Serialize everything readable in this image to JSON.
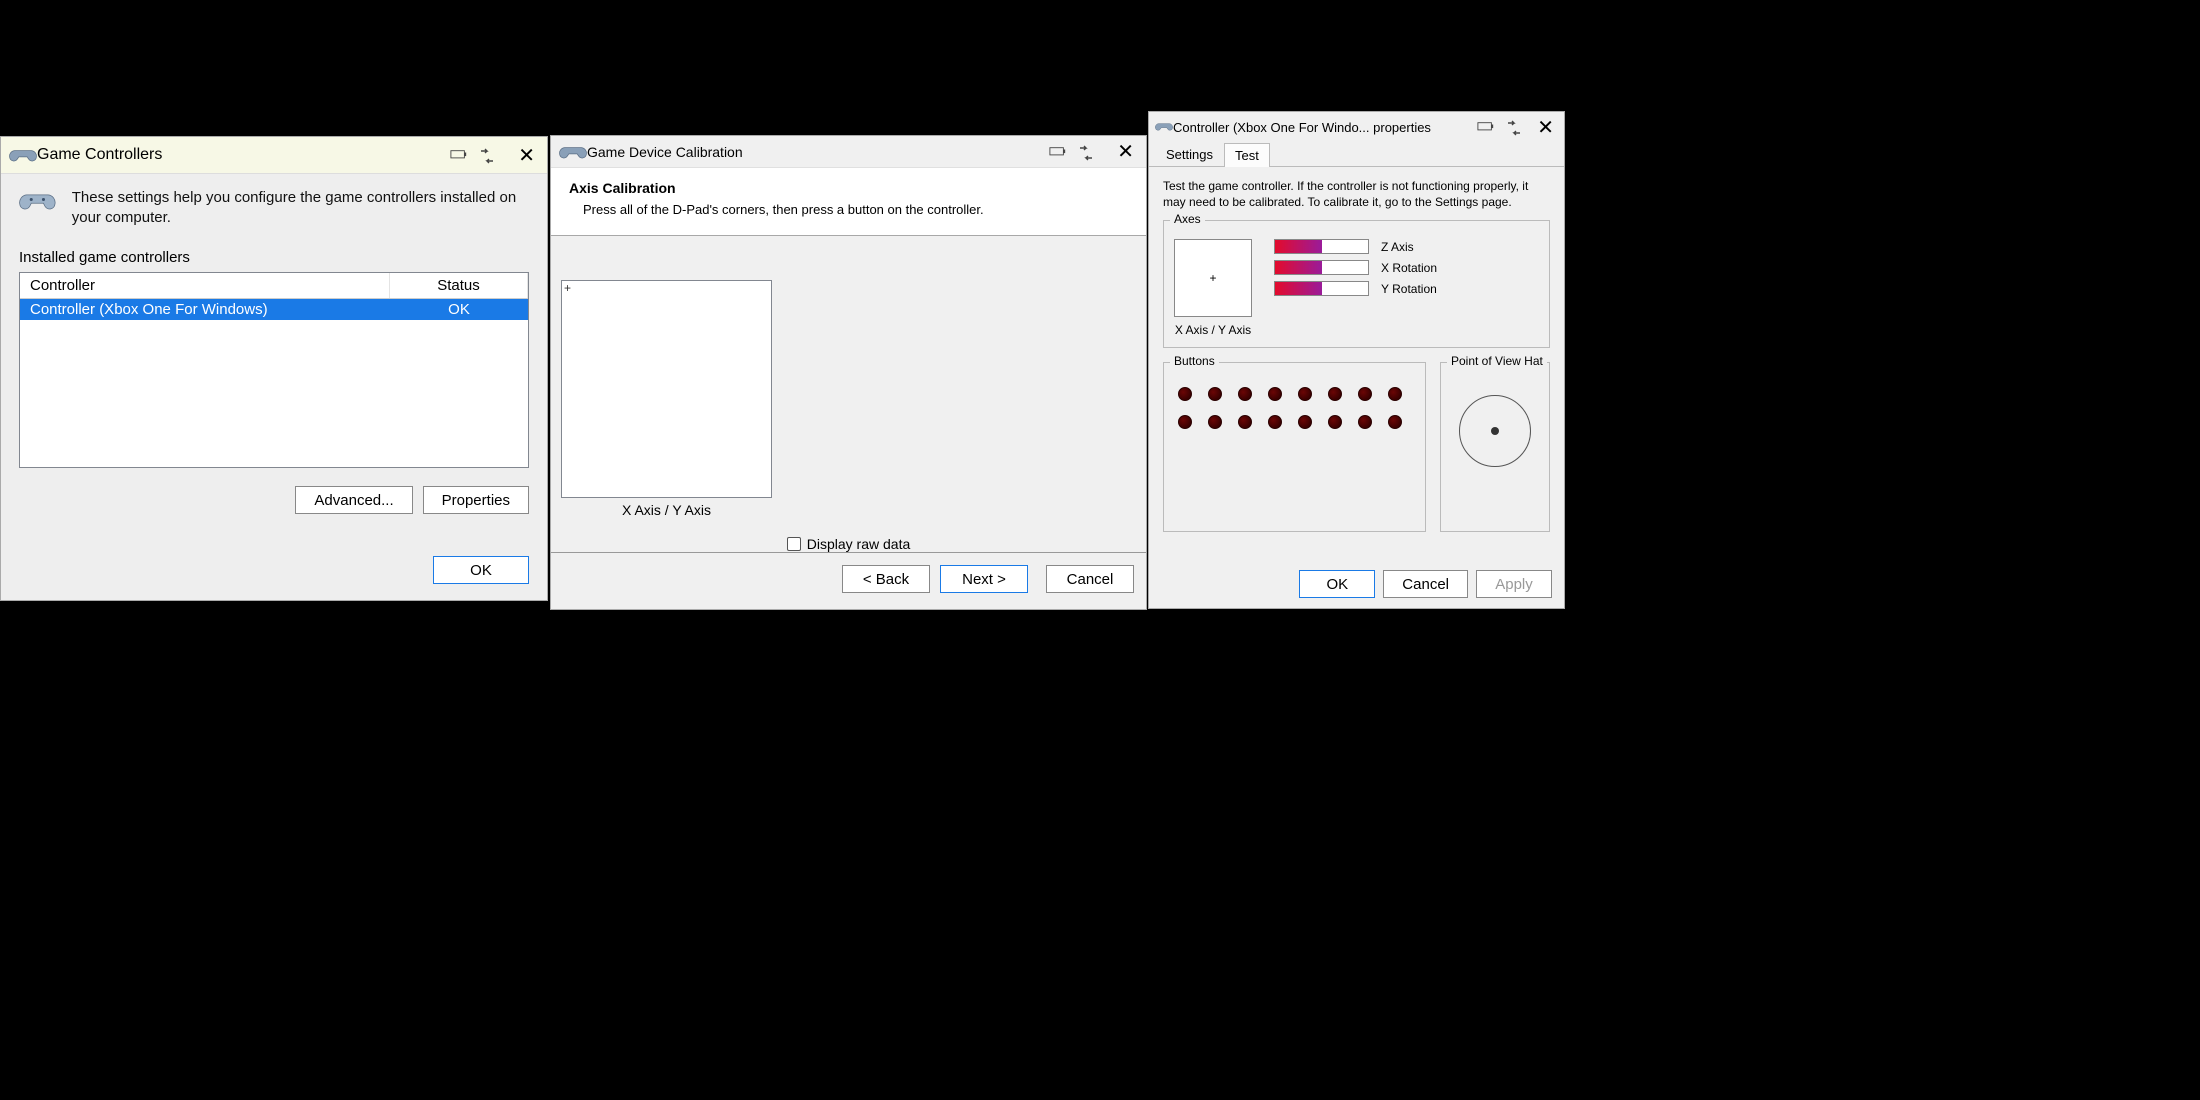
{
  "dialog1": {
    "title": "Game Controllers",
    "intro": "These settings help you configure the game controllers installed on your computer.",
    "list_label": "Installed game controllers",
    "columns": {
      "controller": "Controller",
      "status": "Status"
    },
    "item": {
      "name": "Controller (Xbox One For Windows)",
      "status": "OK"
    },
    "buttons": {
      "advanced": "Advanced...",
      "properties": "Properties",
      "ok": "OK"
    }
  },
  "dialog2": {
    "title": "Game Device Calibration",
    "section_title": "Axis Calibration",
    "section_desc": "Press all of the D-Pad's corners, then press a button on the controller.",
    "axis_label": "X Axis / Y Axis",
    "checkbox_label": "Display raw data",
    "buttons": {
      "back": "< Back",
      "next": "Next >",
      "cancel": "Cancel"
    }
  },
  "dialog3": {
    "title": "Controller (Xbox One For Windo... properties",
    "tabs": {
      "settings": "Settings",
      "test": "Test"
    },
    "instructions": "Test the game controller.  If the controller is not functioning properly, it may need to be calibrated.  To calibrate it, go to the Settings page.",
    "groups": {
      "axes": "Axes",
      "buttons": "Buttons",
      "pov": "Point of View Hat"
    },
    "xy_label": "X Axis / Y Axis",
    "axis_bars": [
      {
        "label": "Z Axis",
        "fill_pct": 50
      },
      {
        "label": "X Rotation",
        "fill_pct": 50
      },
      {
        "label": "Y Rotation",
        "fill_pct": 50
      }
    ],
    "button_count": 16,
    "buttons": {
      "ok": "OK",
      "cancel": "Cancel",
      "apply": "Apply"
    }
  }
}
